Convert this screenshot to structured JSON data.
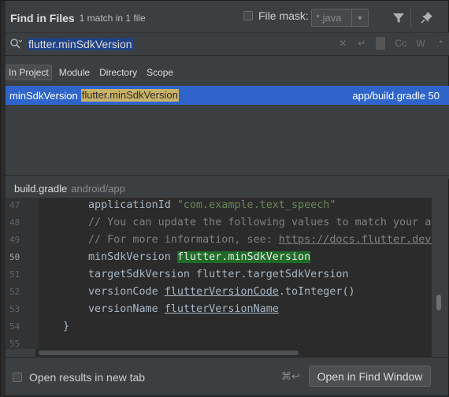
{
  "header": {
    "title": "Find in Files",
    "subtitle": "1 match in 1 file",
    "file_mask_label": "File mask:",
    "file_mask_value": "*.java"
  },
  "search": {
    "query": "flutter.minSdkVersion",
    "options": [
      "Cc",
      "W",
      ".*"
    ]
  },
  "scopes": [
    {
      "label": "In Project",
      "active": true
    },
    {
      "label": "Module",
      "active": false
    },
    {
      "label": "Directory",
      "active": false
    },
    {
      "label": "Scope",
      "active": false
    }
  ],
  "result": {
    "name": "minSdkVersion",
    "match": "flutter.minSdkVersion",
    "location": "app/build.gradle 50"
  },
  "preview": {
    "file": "build.gradle",
    "path": "android/app",
    "lines": [
      {
        "num": "47",
        "kind": "appid",
        "text": "applicationId ",
        "str": "\"com.example.text_speech\""
      },
      {
        "num": "48",
        "kind": "comment",
        "text": "// You can update the following values to match your app"
      },
      {
        "num": "49",
        "kind": "comment-link",
        "text": "// For more information, see: ",
        "link": "https://docs.flutter.dev/d"
      },
      {
        "num": "50",
        "kind": "match",
        "text": "minSdkVersion ",
        "match": "flutter.minSdkVersion"
      },
      {
        "num": "51",
        "kind": "plain",
        "text": "targetSdkVersion flutter.targetSdkVersion"
      },
      {
        "num": "52",
        "kind": "vc",
        "text": "versionCode ",
        "ul": "flutterVersionCode",
        "rest": ".toInteger()"
      },
      {
        "num": "53",
        "kind": "vn",
        "text": "versionName ",
        "ul": "flutterVersionName"
      },
      {
        "num": "54",
        "kind": "brace",
        "text": "}"
      },
      {
        "num": "55",
        "kind": "empty",
        "text": ""
      }
    ]
  },
  "footer": {
    "open_new_tab_label": "Open results in new tab",
    "shortcut": "⌘↩",
    "open_button": "Open in Find Window"
  },
  "icons": {
    "search": "search-icon",
    "filter": "filter-icon",
    "pin": "pin-icon",
    "clear": "clear-icon",
    "newline": "newline-icon"
  },
  "colors": {
    "selection": "#2f65ca",
    "match_highlight": "#c9b268",
    "preview_match": "#1f6b27",
    "query_selection": "#214283"
  }
}
